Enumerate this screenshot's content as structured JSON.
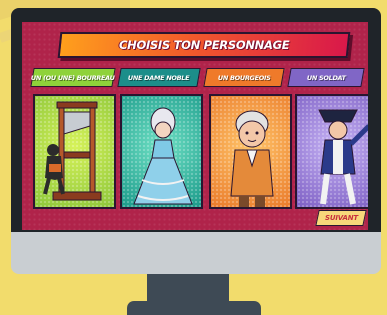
{
  "screen": {
    "title": "CHOISIS TON PERSONNAGE",
    "characters": [
      {
        "label": "UN (OU UNE) BOURREAU",
        "color": "#8fd23a",
        "icon": "executioner-guillotine-icon"
      },
      {
        "label": "UNE DAME NOBLE",
        "color": "#1c8e8a",
        "icon": "noble-lady-icon"
      },
      {
        "label": "UN BOURGEOIS",
        "color": "#ef7a2a",
        "icon": "bourgeois-man-icon"
      },
      {
        "label": "UN SOLDAT",
        "color": "#8066c6",
        "icon": "soldier-icon"
      }
    ],
    "next_label": "SUIVANT"
  },
  "colors": {
    "background": "#f2dc6c",
    "screen": "#b0234a",
    "monitor_frame": "#1f2429",
    "monitor_chin": "#c9ced2",
    "stand": "#3e4a55"
  }
}
